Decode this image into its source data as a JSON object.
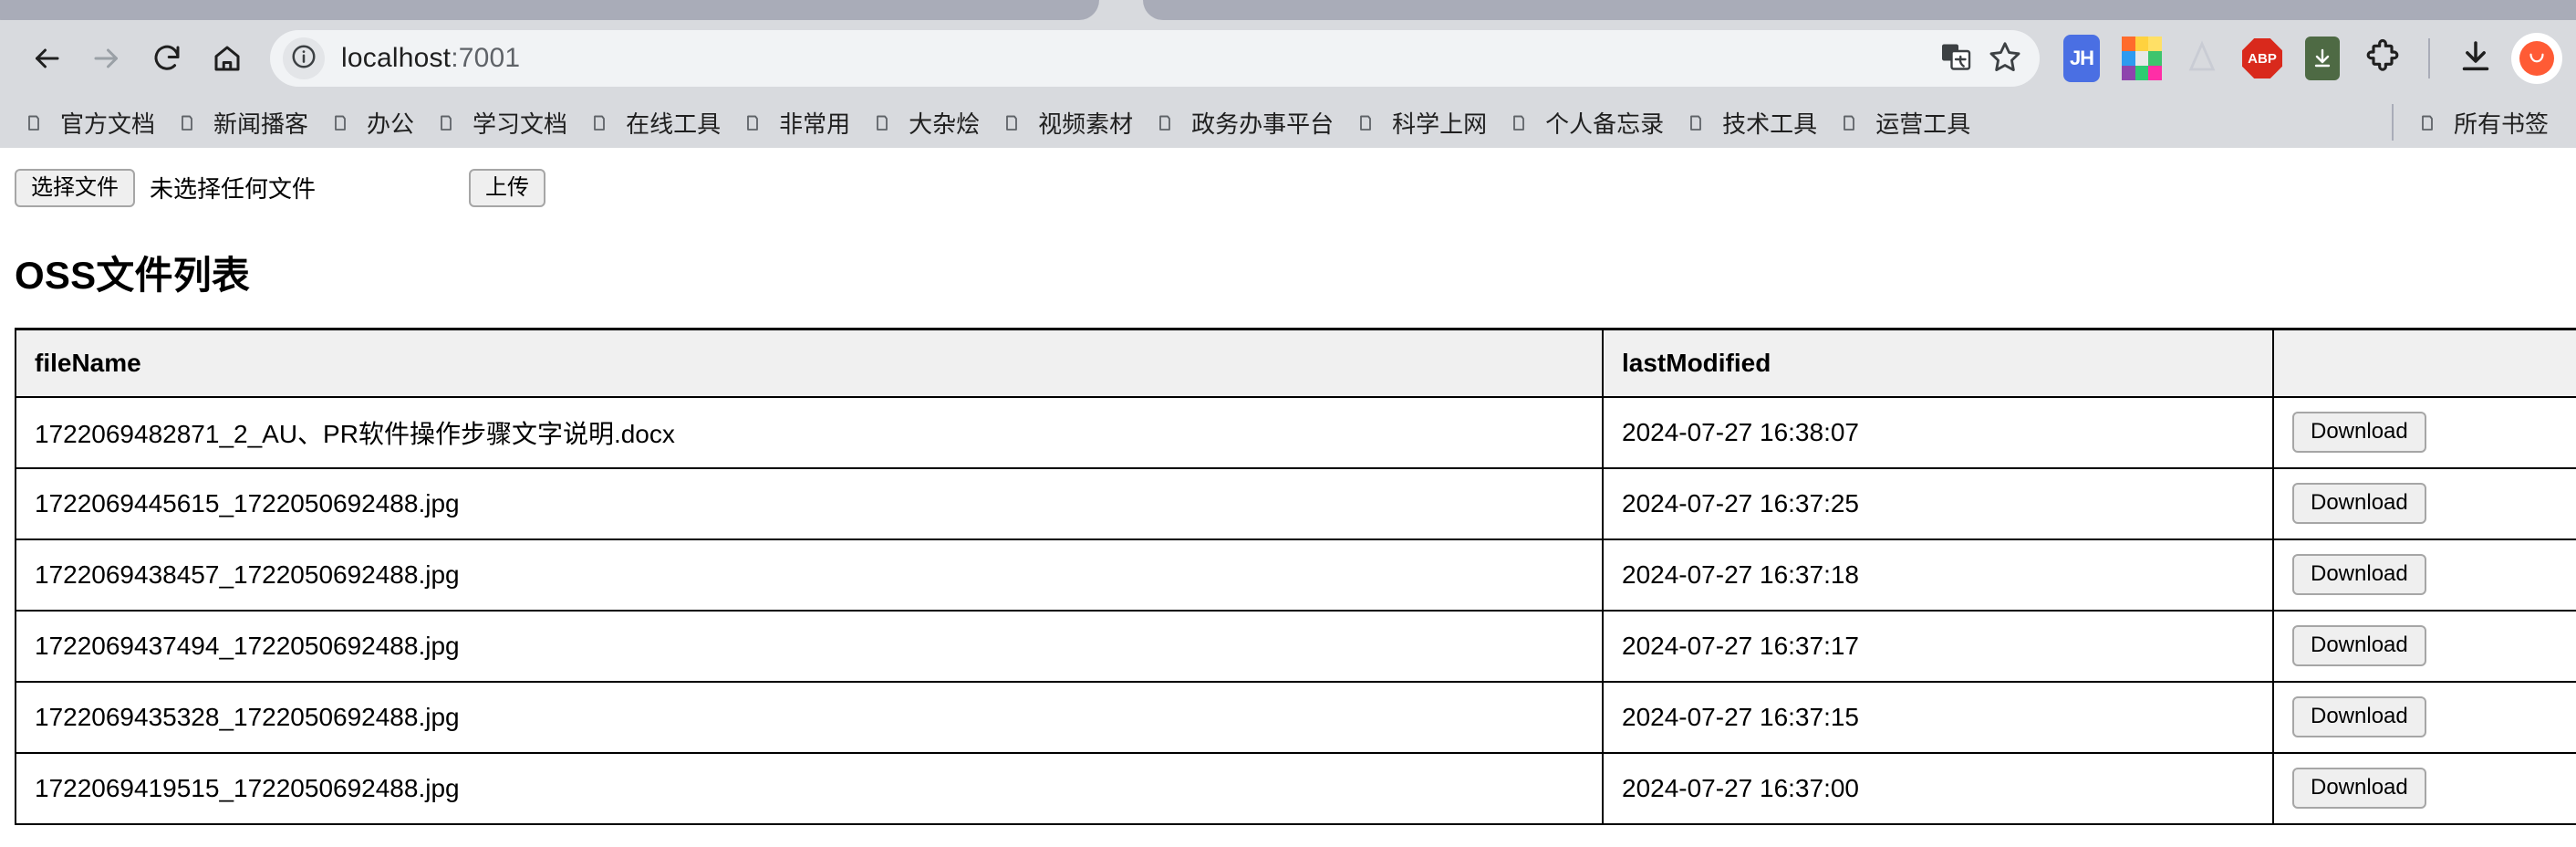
{
  "browser": {
    "nav": {
      "back_icon": "arrow-left-icon",
      "forward_icon": "arrow-right-icon",
      "reload_icon": "reload-icon",
      "home_icon": "home-icon"
    },
    "omnibox": {
      "site_info_icon": "info-circle-icon",
      "url_host": "localhost",
      "url_port": ":7001",
      "translate_icon": "translate-icon",
      "bookmark_star_icon": "star-icon"
    },
    "extensions": [
      {
        "name": "jh-extension-icon",
        "label": "JH"
      },
      {
        "name": "color-grid-extension-icon",
        "label": ""
      },
      {
        "name": "triangle-extension-icon",
        "label": ""
      },
      {
        "name": "adblock-plus-icon",
        "label": "ABP"
      },
      {
        "name": "idm-download-extension-icon",
        "label": ""
      },
      {
        "name": "puzzle-extensions-icon",
        "label": ""
      }
    ],
    "downloads_icon": "download-tray-icon",
    "avatar_icon": "profile-avatar-icon"
  },
  "bookmarks": {
    "items": [
      {
        "label": "官方文档"
      },
      {
        "label": "新闻播客"
      },
      {
        "label": "办公"
      },
      {
        "label": "学习文档"
      },
      {
        "label": "在线工具"
      },
      {
        "label": "非常用"
      },
      {
        "label": "大杂烩"
      },
      {
        "label": "视频素材"
      },
      {
        "label": "政务办事平台"
      },
      {
        "label": "科学上网"
      },
      {
        "label": "个人备忘录"
      },
      {
        "label": "技术工具"
      },
      {
        "label": "运营工具"
      }
    ],
    "all_bookmarks": {
      "label": "所有书签"
    }
  },
  "upload": {
    "choose_file_label": "选择文件",
    "file_status": "未选择任何文件",
    "upload_label": "上传"
  },
  "main": {
    "title": "OSS文件列表",
    "table": {
      "headers": [
        "fileName",
        "lastModified",
        ""
      ],
      "rows": [
        {
          "fileName": "1722069482871_2_AU、PR软件操作步骤文字说明.docx",
          "lastModified": "2024-07-27 16:38:07",
          "action": "Download"
        },
        {
          "fileName": "1722069445615_1722050692488.jpg",
          "lastModified": "2024-07-27 16:37:25",
          "action": "Download"
        },
        {
          "fileName": "1722069438457_1722050692488.jpg",
          "lastModified": "2024-07-27 16:37:18",
          "action": "Download"
        },
        {
          "fileName": "1722069437494_1722050692488.jpg",
          "lastModified": "2024-07-27 16:37:17",
          "action": "Download"
        },
        {
          "fileName": "1722069435328_1722050692488.jpg",
          "lastModified": "2024-07-27 16:37:15",
          "action": "Download"
        },
        {
          "fileName": "1722069419515_1722050692488.jpg",
          "lastModified": "2024-07-27 16:37:00",
          "action": "Download"
        }
      ]
    }
  },
  "colors": {
    "chrome_bg": "#d8dade",
    "tab_inactive": "#a9acb8",
    "omnibox_bg": "#f1f3f5",
    "table_header_bg": "#f0f0f0",
    "button_bg": "#efefef",
    "avatar": "#ff5b35"
  }
}
